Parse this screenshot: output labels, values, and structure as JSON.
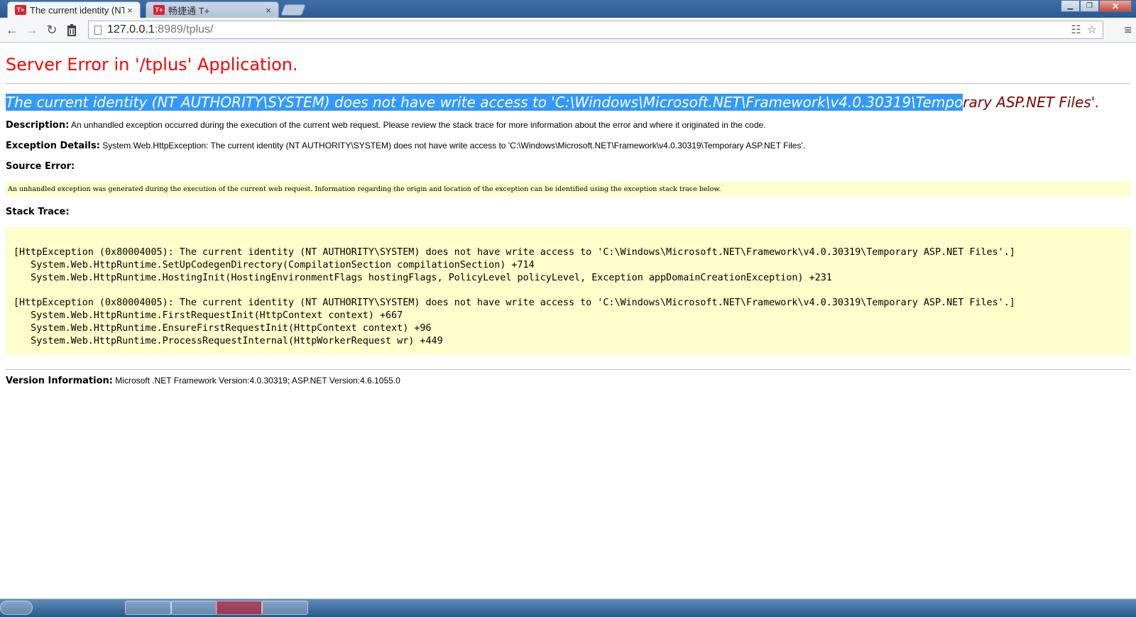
{
  "browser": {
    "tabs": [
      {
        "title": "The current identity (NT",
        "favicon": "T+",
        "active": true
      },
      {
        "title": "畅捷通 T+",
        "favicon": "T+",
        "active": false
      }
    ],
    "tab_close_glyph": "×",
    "url": {
      "host": "127.0.0.1",
      "rest": ":8989/tplus/"
    },
    "icons": [
      "back-arrow-icon",
      "forward-arrow-icon",
      "reload-icon",
      "trash-icon",
      "page-icon",
      "translate-icon",
      "star-icon",
      "menu-icon"
    ]
  },
  "page": {
    "title": "Server Error in '/tplus' Application.",
    "heading_selected": "The current identity (NT AUTHORITY\\SYSTEM) does not have write access to 'C:\\Windows\\Microsoft.NET\\Framework\\v4.0.30319\\Tempo",
    "heading_rest": "rary ASP.NET Files'.",
    "description_label": "Description:",
    "description_text": "An unhandled exception occurred during the execution of the current web request. Please review the stack trace for more information about the error and where it originated in the code.",
    "exception_label": "Exception Details:",
    "exception_text": "System.Web.HttpException: The current identity (NT AUTHORITY\\SYSTEM) does not have write access to 'C:\\Windows\\Microsoft.NET\\Framework\\v4.0.30319\\Temporary ASP.NET Files'.",
    "source_label": "Source Error:",
    "source_text": "An unhandled exception was generated during the execution of the current web request. Information regarding the origin and location of the exception can be identified using the exception stack trace below.",
    "stack_label": "Stack Trace:",
    "stack_text": "[HttpException (0x80004005): The current identity (NT AUTHORITY\\SYSTEM) does not have write access to 'C:\\Windows\\Microsoft.NET\\Framework\\v4.0.30319\\Temporary ASP.NET Files'.]\n   System.Web.HttpRuntime.SetUpCodegenDirectory(CompilationSection compilationSection) +714\n   System.Web.HttpRuntime.HostingInit(HostingEnvironmentFlags hostingFlags, PolicyLevel policyLevel, Exception appDomainCreationException) +231\n\n[HttpException (0x80004005): The current identity (NT AUTHORITY\\SYSTEM) does not have write access to 'C:\\Windows\\Microsoft.NET\\Framework\\v4.0.30319\\Temporary ASP.NET Files'.]\n   System.Web.HttpRuntime.FirstRequestInit(HttpContext context) +667\n   System.Web.HttpRuntime.EnsureFirstRequestInit(HttpContext context) +96\n   System.Web.HttpRuntime.ProcessRequestInternal(HttpWorkerRequest wr) +449",
    "version_label": "Version Information:",
    "version_text": "Microsoft .NET Framework Version:4.0.30319; ASP.NET Version:4.6.1055.0"
  },
  "colors": {
    "title_red": "#ff0000",
    "heading_maroon": "#800000",
    "selection_blue": "#3399ff",
    "code_background": "#ffffcc"
  }
}
